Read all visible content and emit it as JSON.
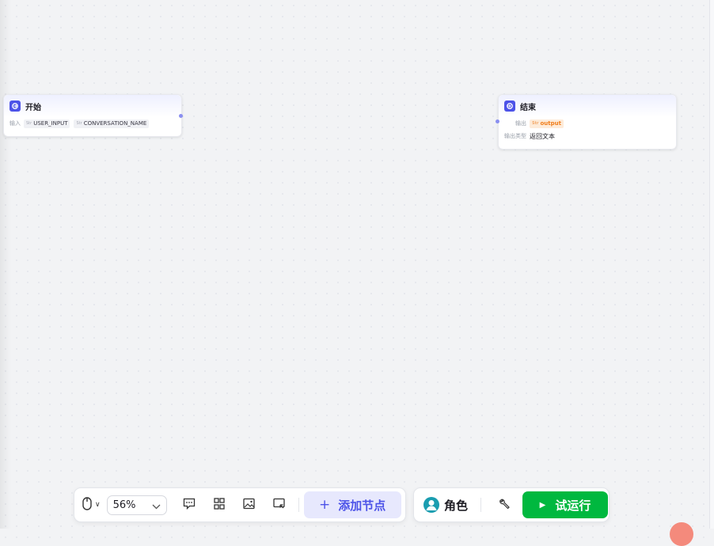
{
  "start_node": {
    "title": "开始",
    "input_label": "输入",
    "inputs": [
      {
        "type": "Str",
        "name": "USER_INPUT"
      },
      {
        "type": "Str",
        "name": "CONVERSATION_NAME"
      }
    ]
  },
  "end_node": {
    "title": "结束",
    "output_label": "输出",
    "output": {
      "type": "Str",
      "name": "output"
    },
    "output_type_label": "输出类型",
    "output_type_value": "返回文本"
  },
  "toolbar": {
    "zoom_value": "56%",
    "add_node_label": "添加节点",
    "role_label": "角色",
    "run_label": "试运行"
  },
  "colors": {
    "accent": "#4d53e8",
    "run_green": "#00b83f",
    "output_orange": "#f07d1a"
  }
}
